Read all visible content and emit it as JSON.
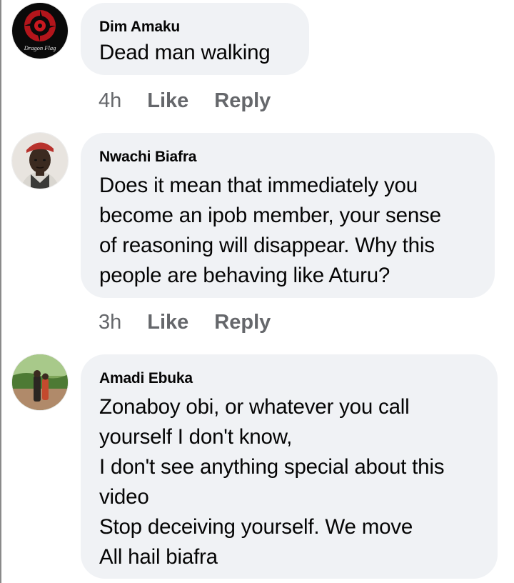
{
  "comments": [
    {
      "author": "Dim Amaku",
      "text": "Dead man walking",
      "time": "4h",
      "like_label": "Like",
      "reply_label": "Reply",
      "avatar_text": "Dragon Flag"
    },
    {
      "author": "Nwachi Biafra",
      "text": "Does it mean that immediately you\nbecome an ipob member,  your sense\nof reasoning will disappear. Why this\npeople are behaving like Aturu?",
      "time": "3h",
      "like_label": "Like",
      "reply_label": "Reply"
    },
    {
      "author": "Amadi Ebuka",
      "text": "Zonaboy obi, or whatever you call\nyourself I don't know,\nI don't see anything special about this\nvideo\nStop deceiving yourself. We move\nAll hail biafra"
    }
  ],
  "colors": {
    "bubble_bg": "#f0f2f5",
    "text": "#050505",
    "meta": "#65676b"
  }
}
